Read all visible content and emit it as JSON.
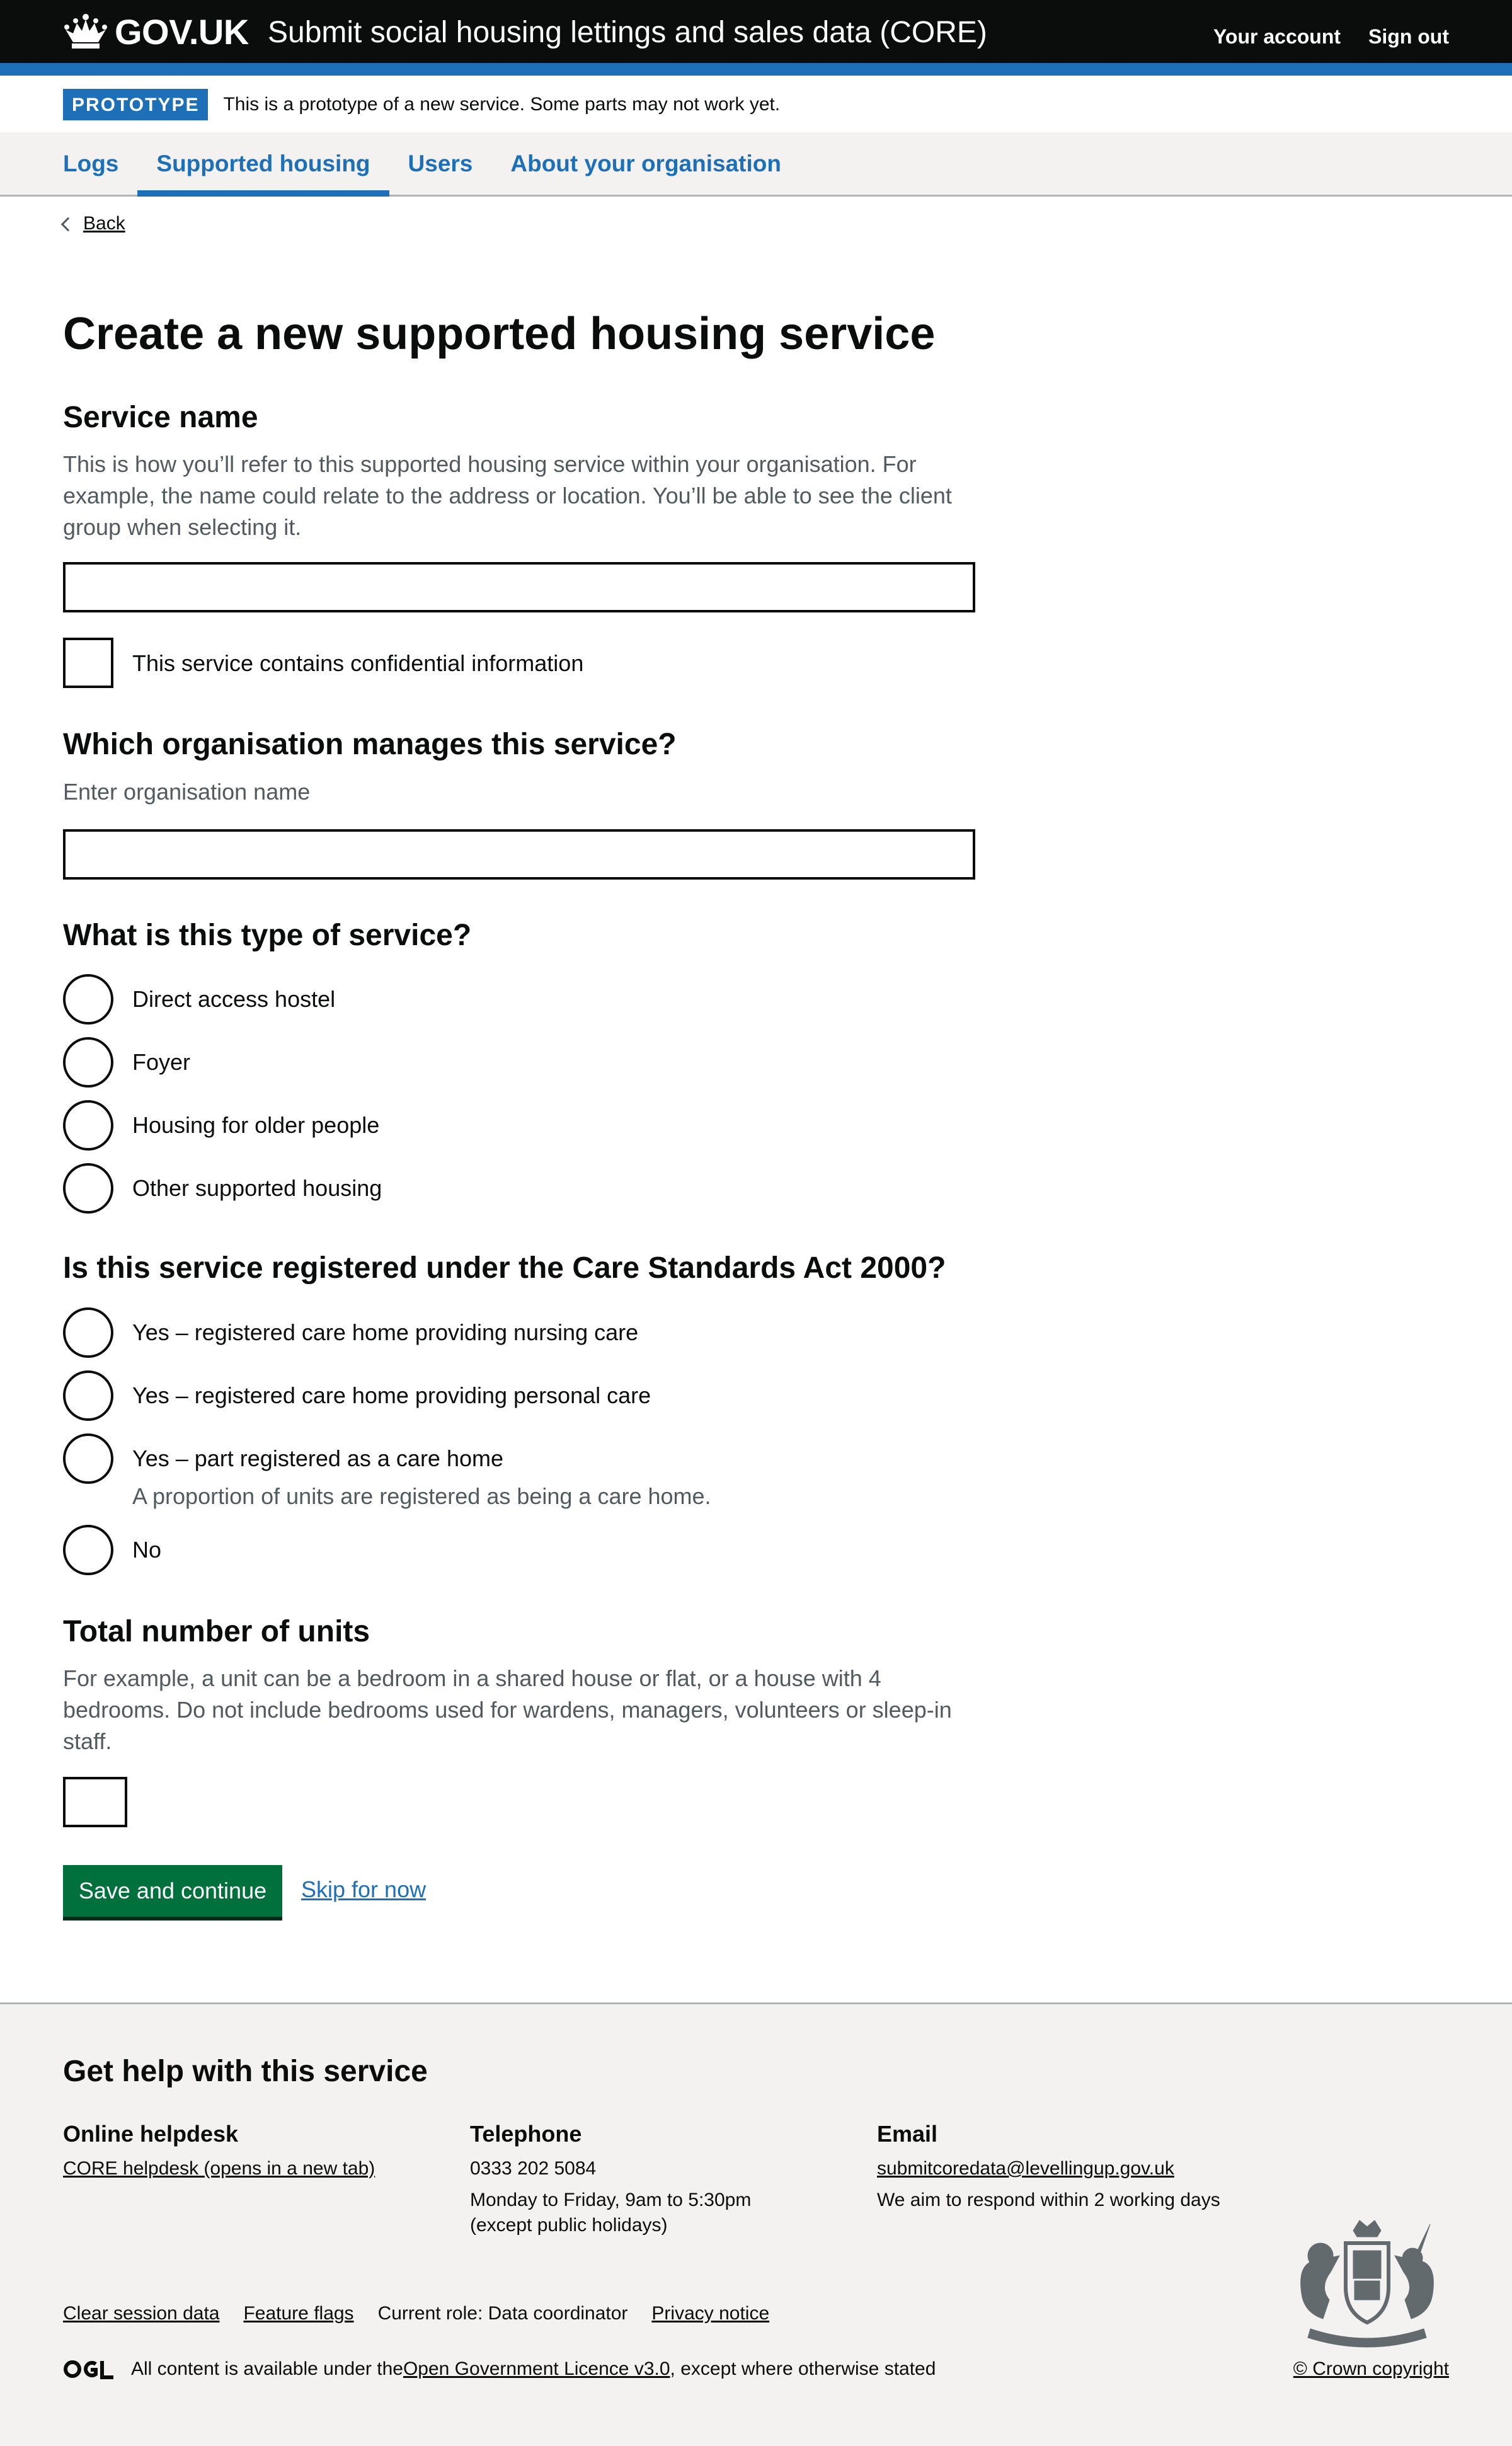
{
  "header": {
    "logo_text": "GOV.UK",
    "service_name": "Submit social housing lettings and sales data (CORE)",
    "nav": [
      "Your account",
      "Sign out"
    ]
  },
  "phase": {
    "tag": "PROTOTYPE",
    "text": "This is a prototype of a new service. Some parts may not work yet."
  },
  "primary_nav": [
    {
      "label": "Logs",
      "active": false
    },
    {
      "label": "Supported housing",
      "active": true
    },
    {
      "label": "Users",
      "active": false
    },
    {
      "label": "About your organisation",
      "active": false
    }
  ],
  "back_label": "Back",
  "title": "Create a new supported housing service",
  "service_name": {
    "heading": "Service name",
    "hint": "This is how you’ll refer to this supported housing service within your organisation. For example, the name could relate to the address or location. You’ll be able to see the client group when selecting it.",
    "value": "",
    "confidential_label": "This service contains confidential information"
  },
  "organisation": {
    "heading": "Which organisation manages this service?",
    "hint": "Enter organisation name",
    "value": ""
  },
  "service_type": {
    "heading": "What is this type of service?",
    "options": [
      "Direct access hostel",
      "Foyer",
      "Housing for older people",
      "Other supported housing"
    ]
  },
  "care_standards": {
    "heading": "Is this service registered under the Care Standards Act 2000?",
    "options": [
      "Yes – registered care home providing nursing care",
      "Yes – registered care home providing personal care",
      "Yes – part registered as a care home",
      "No"
    ],
    "part_hint": "A proportion of units are registered as being a care home."
  },
  "units": {
    "heading": "Total number of units",
    "hint": "For example, a unit can be a bedroom in a shared house or flat, or a house with 4 bedrooms. Do not include bedrooms used for wardens, managers, volunteers or sleep-in staff.",
    "value": ""
  },
  "actions": {
    "save_label": "Save and continue",
    "skip_label": "Skip for now"
  },
  "footer": {
    "heading": "Get help with this service",
    "helpdesk": {
      "heading": "Online helpdesk",
      "link": "CORE helpdesk (opens in a new tab)"
    },
    "telephone": {
      "heading": "Telephone",
      "number": "0333 202 5084",
      "hours_1": "Monday to Friday, 9am to 5:30pm",
      "hours_2": "(except public holidays)"
    },
    "email": {
      "heading": "Email",
      "address": "submitcoredata@levellingup.gov.uk",
      "note": "We aim to respond within 2 working days"
    },
    "meta": {
      "clear": "Clear session data",
      "flags": "Feature flags",
      "role": "Current role: Data coordinator",
      "privacy": "Privacy notice"
    },
    "licence_pre": "All content is available under the ",
    "licence_link": "Open Government Licence v3.0",
    "licence_post": ", except where otherwise stated",
    "copyright": "© Crown copyright"
  },
  "colors": {
    "header_bg": "#0b0c0c",
    "brand_blue": "#1d70b8",
    "button_green": "#00703c",
    "hint_grey": "#505a5f",
    "footer_bg": "#f3f2f1"
  }
}
